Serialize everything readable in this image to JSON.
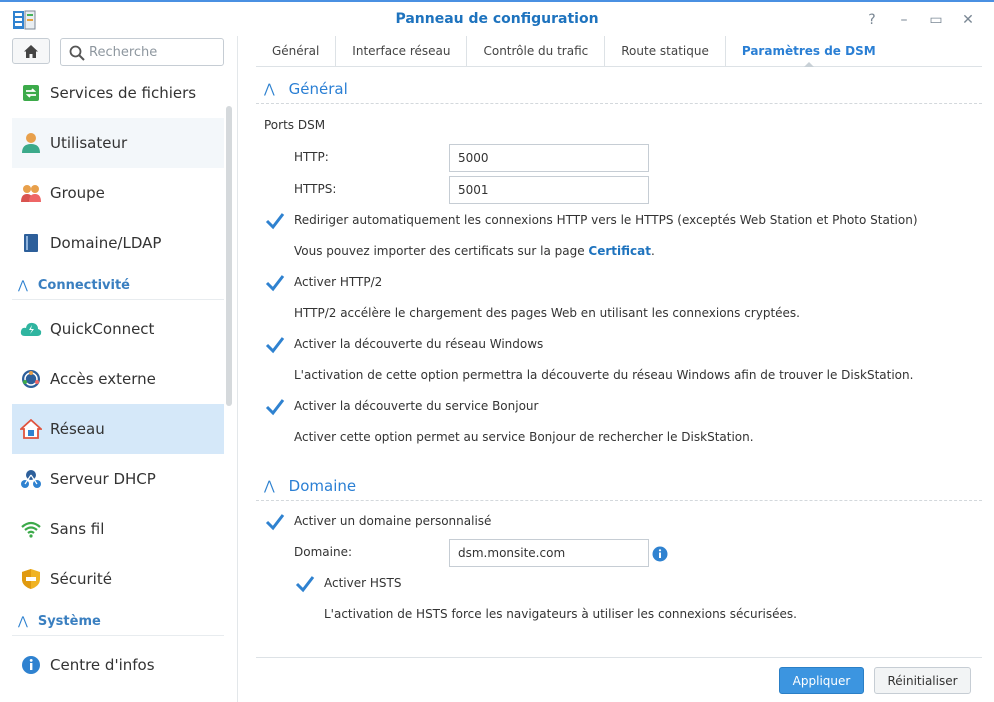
{
  "window": {
    "title": "Panneau de configuration",
    "help": "?",
    "minimize": "–",
    "maximize": "▭",
    "close": "✕"
  },
  "sidebar": {
    "search_placeholder": "Recherche",
    "items": [
      {
        "label": "Services de fichiers"
      },
      {
        "label": "Utilisateur"
      },
      {
        "label": "Groupe"
      },
      {
        "label": "Domaine/LDAP"
      }
    ],
    "section_connectivity": "Connectivité",
    "items_connectivity": [
      {
        "label": "QuickConnect"
      },
      {
        "label": "Accès externe"
      },
      {
        "label": "Réseau"
      },
      {
        "label": "Serveur DHCP"
      },
      {
        "label": "Sans fil"
      },
      {
        "label": "Sécurité"
      }
    ],
    "section_system": "Système",
    "items_system": [
      {
        "label": "Centre d'infos"
      }
    ]
  },
  "tabs": [
    {
      "label": "Général"
    },
    {
      "label": "Interface réseau"
    },
    {
      "label": "Contrôle du trafic"
    },
    {
      "label": "Route statique"
    },
    {
      "label": "Paramètres de DSM"
    }
  ],
  "general": {
    "title": "Général",
    "ports_label": "Ports DSM",
    "http_label": "HTTP:",
    "http_value": "5000",
    "https_label": "HTTPS:",
    "https_value": "5001",
    "redirect_label": "Rediriger automatiquement les connexions HTTP vers le HTTPS (exceptés Web Station et Photo Station)",
    "cert_text": "Vous pouvez importer des certificats sur la page ",
    "cert_link": "Certificat",
    "cert_period": ".",
    "http2_label": "Activer HTTP/2",
    "http2_desc": "HTTP/2 accélère le chargement des pages Web en utilisant les connexions cryptées.",
    "windows_label": "Activer la découverte du réseau Windows",
    "windows_desc": "L'activation de cette option permettra la découverte du réseau Windows afin de trouver le DiskStation.",
    "bonjour_label": "Activer la découverte du service Bonjour",
    "bonjour_desc": "Activer cette option permet au service Bonjour de rechercher le DiskStation."
  },
  "domain": {
    "title": "Domaine",
    "custom_label": "Activer un domaine personnalisé",
    "domain_label": "Domaine:",
    "domain_value": "dsm.monsite.com",
    "hsts_label": "Activer HSTS",
    "hsts_desc": "L'activation de HSTS force les navigateurs à utiliser les connexions sécurisées."
  },
  "buttons": {
    "apply": "Appliquer",
    "reset": "Réinitialiser"
  },
  "colors": {
    "accent": "#2a7fd4",
    "selected_bg": "#d5e8f9",
    "check": "#2f82d0"
  }
}
